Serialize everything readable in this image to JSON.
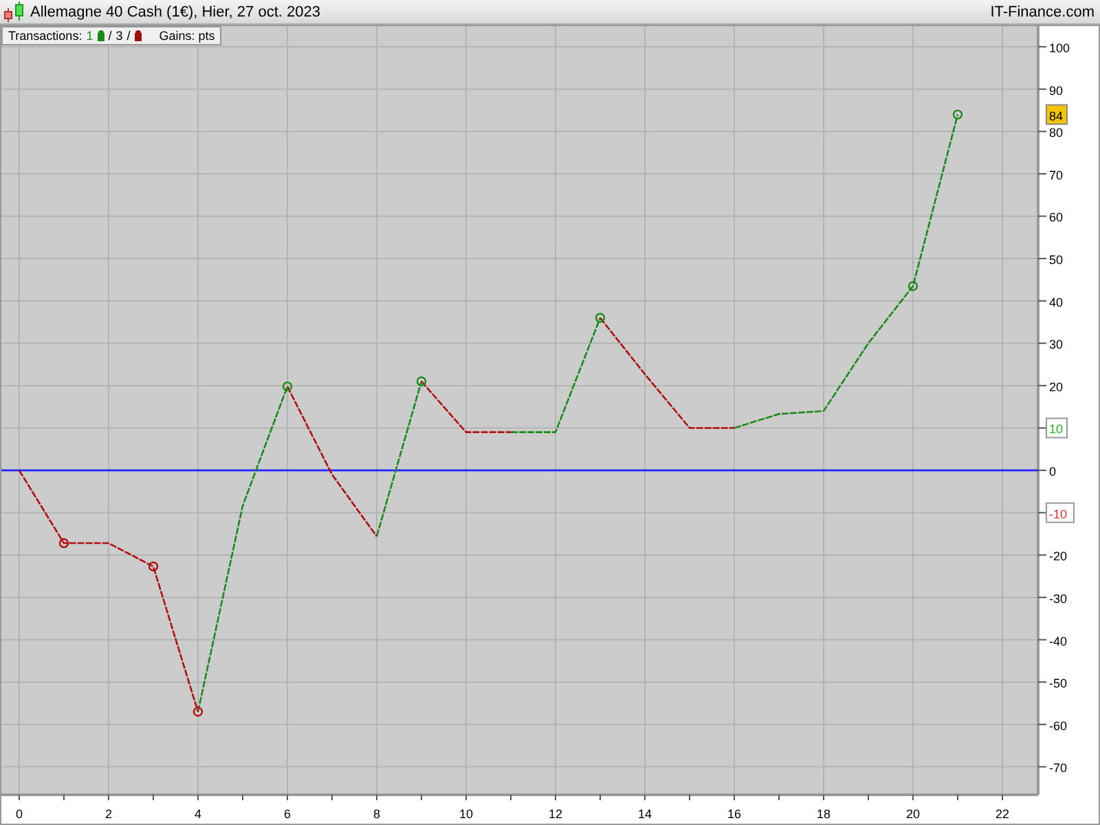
{
  "window": {
    "title": "Allemagne 40 Cash (1€), Hier, 27 oct. 2023",
    "brand": "IT-Finance.com"
  },
  "legend": {
    "label": "Transactions:",
    "wins": "1",
    "separator": "/",
    "total": "3",
    "separator_2": "/",
    "gains": "Gains: pts"
  },
  "chart": {
    "chart_data": {
      "type": "line",
      "x": [
        0,
        1,
        2,
        3,
        4,
        5,
        6,
        7,
        8,
        8.5,
        9,
        10,
        11,
        12,
        13,
        14,
        15,
        16,
        17,
        18,
        19,
        20,
        21
      ],
      "series": [
        {
          "color": "#1a8a1a",
          "line_style": "dashed",
          "values": [
            null,
            null,
            null,
            null,
            -57,
            -8.4,
            19.8,
            null,
            -15.6,
            2.7,
            21,
            null,
            9,
            9,
            36,
            null,
            null,
            10,
            13.3,
            14,
            30,
            43.5,
            84
          ]
        },
        {
          "color": "#b01010",
          "line_style": "dashed",
          "values": [
            0,
            -17.2,
            -17.2,
            -22.7,
            -57,
            null,
            19.8,
            -1,
            -15.6,
            null,
            21,
            9,
            9,
            null,
            36,
            22.7,
            10,
            10,
            null,
            null,
            null,
            null,
            null
          ]
        },
        {
          "color": "#b01010",
          "type": "scatter",
          "marker": "circle",
          "values": [
            null,
            -17.2,
            null,
            -22.7,
            -57,
            null,
            null,
            null,
            null,
            null,
            null,
            null,
            null,
            null,
            null,
            null,
            null,
            null,
            null,
            null,
            null,
            null,
            null
          ]
        },
        {
          "color": "#1a8a1a",
          "type": "scatter",
          "marker": "circle",
          "values": [
            null,
            null,
            null,
            null,
            null,
            null,
            19.8,
            null,
            null,
            null,
            21,
            null,
            null,
            null,
            36,
            null,
            null,
            null,
            null,
            null,
            null,
            43.5,
            84
          ]
        }
      ],
      "xlim": [
        -0.43,
        22.8
      ],
      "ylim": [
        -76.6,
        105.2
      ],
      "grid": true,
      "xticks": [
        0,
        2,
        4,
        6,
        8,
        10,
        12,
        14,
        16,
        18,
        20,
        22
      ],
      "yticks": [
        -70,
        -60,
        -50,
        -40,
        -30,
        -20,
        -10,
        0,
        10,
        20,
        30,
        40,
        50,
        60,
        70,
        80,
        90,
        100
      ],
      "ref_lines": [
        {
          "axis": "y",
          "value": 0,
          "color": "#2020ff"
        }
      ]
    },
    "value_tags": [
      {
        "kind": "last",
        "label": "84"
      },
      {
        "kind": "gain",
        "label": "10"
      },
      {
        "kind": "loss",
        "label": "-10"
      }
    ]
  }
}
